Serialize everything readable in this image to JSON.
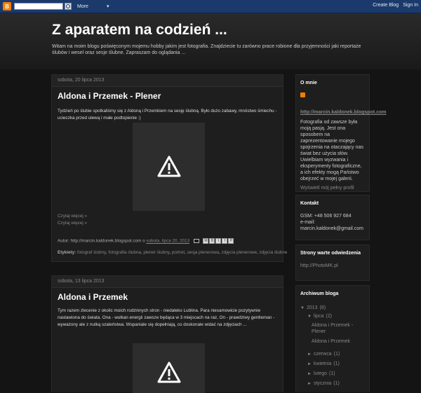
{
  "navbar": {
    "logo_letter": "B",
    "search_value": "",
    "more_label": "More",
    "more_chevron": "▾",
    "create_blog": "Create Blog",
    "sign_in": "Sign In"
  },
  "blog": {
    "title": "Z aparatem na codzień ...",
    "description": "Witam na moim blogu poświęconym mojemu hobby jakim jest fotografia. Znajdziecie tu zarówno prace robione dla przyjemności jaki reportaże ślubów i wesel oraz sesje ślubne. Zapraszam do oglądania ..."
  },
  "posts": [
    {
      "date": "sobota, 20 lipca 2013",
      "title": "Aldona i Przemek - Plener",
      "body": "Tydzień po ślubie spotkaliśmy się z Aldoną i Przemkiem na sesję ślubną. Było dużo zabawy, mnóstwo śmiechu - ucieczka przed ulewą i małe podtopienie :)",
      "read_more_1": "Czytaj więcej »",
      "read_more_2": "Czytaj więcej »",
      "author_prefix": "Autor: http://marcin.kaldonek.blogspot.com o",
      "time": "sobota, lipca 20, 2013",
      "labels_prefix": "Etykiety:",
      "labels": [
        "fotograf ślubny",
        "fotografia ślubna",
        "plener ślubny",
        "portret",
        "sesja plenerowa",
        "zdjęcia plenerowe",
        "zdjęcia ślubne"
      ]
    },
    {
      "date": "sobota, 13 lipca 2013",
      "title": "Aldona i Przemek",
      "body": "Tym razem zlecenie z okolic moich rodzinnych stron - niedaleko Lublina. Para niesamowicie pozytywnie nastawiona do świata. Ona - wulkan energii zawsze będąca w 3 miejscach na raz, On - prawdziwy gentleman - wyważony ale z nutką szaleństwa. Wspaniale się dopełniają, co doskonale widać na zdjęciach ..."
    }
  ],
  "share_buttons": [
    "M",
    "B",
    "t",
    "f",
    "P"
  ],
  "sidebar": {
    "about_title": "O mnie",
    "profile_name": "http://marcin.kaldonek.blogspot.com",
    "about_text": "Fotografia od zawsze była moją pasją. Jest ona sposobem na zaprezentowanie mojego spojrzenia na otaczający nas świat bez użycia słów. Uwielbiam wyzwania i eksperymenty fotograficzne, a ich efekty mogą Państwo obejrzeć w mojej galerii.",
    "view_profile": "Wyświetl mój pełny profil",
    "contact_title": "Kontakt",
    "contact_phone": "GSM: +48 506 927 684",
    "contact_email_label": "e-mail:",
    "contact_email": "marcin.kaldonek@gmail.com",
    "links_title": "Strony warte odwiedzenia",
    "link_1": "http://PhotoMK.pl",
    "archive_title": "Archiwum bloga",
    "archive": {
      "year": "2013",
      "year_count": "(8)",
      "open_month": "lipca",
      "open_month_count": "(2)",
      "open_posts": [
        "Aldona i Przemek - Plener",
        "Aldona i Przemek"
      ],
      "months": [
        {
          "name": "czerwca",
          "count": "(1)"
        },
        {
          "name": "kwietnia",
          "count": "(1)"
        },
        {
          "name": "lutego",
          "count": "(1)"
        },
        {
          "name": "stycznia",
          "count": "(1)"
        }
      ]
    }
  }
}
